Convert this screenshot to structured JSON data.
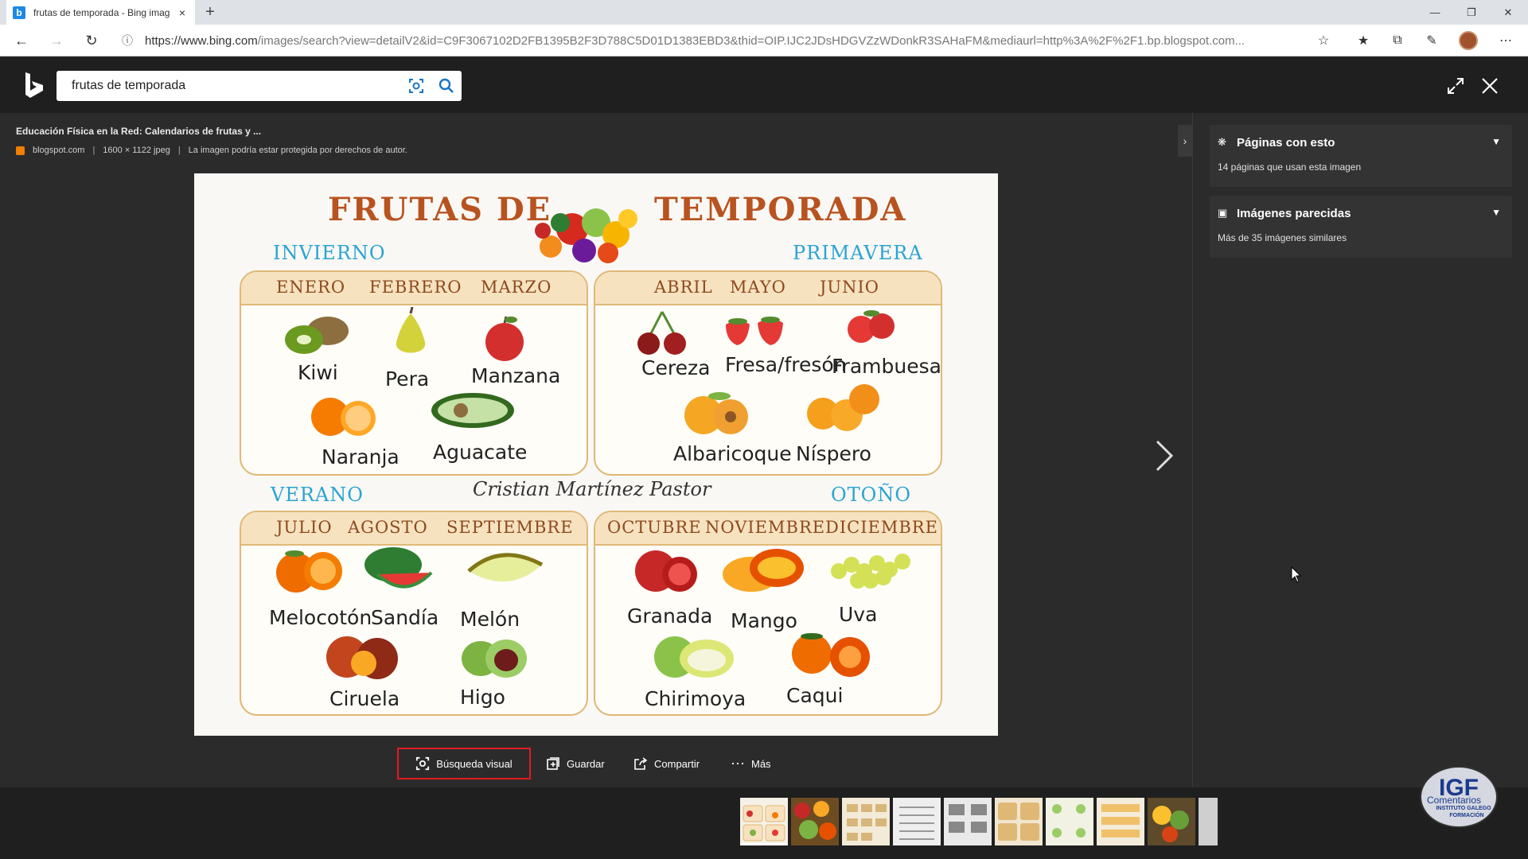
{
  "browser": {
    "tab_title": "frutas de temporada - Bing imag",
    "tab_close": "×",
    "new_tab": "+",
    "url_host": "https://www.bing.com",
    "url_path": "/images/search?view=detailV2&id=C9F3067102D2FB1395B2F3D788C5D01D1383EBD3&thid=OIP.IJC2JDsHDGVZzWDonkR3SAHaFM&mediaurl=http%3A%2F%2F1.bp.blogspot.com..."
  },
  "bing": {
    "search_query": "frutas de temporada"
  },
  "image_info": {
    "title": "Educación Física en la Red: Calendarios de frutas y ...",
    "source": "blogspot.com",
    "dimensions": "1600 × 1122 jpeg",
    "copyright": "La imagen podría estar protegida por derechos de autor."
  },
  "poster": {
    "title_left": "FRUTAS  DE",
    "title_right": "TEMPORADA",
    "author": "Cristian Martínez Pastor",
    "seasons": {
      "winter": "INVIERNO",
      "spring": "PRIMAVERA",
      "summer": "VERANO",
      "autumn": "OTOÑO"
    },
    "months": {
      "winter": [
        "ENERO",
        "FEBRERO",
        "MARZO"
      ],
      "spring": [
        "ABRIL",
        "MAYO",
        "JUNIO"
      ],
      "summer": [
        "JULIO",
        "AGOSTO",
        "SEPTIEMBRE"
      ],
      "autumn": [
        "OCTUBRE",
        "NOVIEMBRE",
        "DICIEMBRE"
      ]
    },
    "fruits": {
      "winter": [
        "Kiwi",
        "Pera",
        "Manzana",
        "Naranja",
        "Aguacate"
      ],
      "spring": [
        "Cereza",
        "Fresa/fresón",
        "Frambuesa",
        "Albaricoque",
        "Níspero"
      ],
      "summer": [
        "Melocotón",
        "Sandía",
        "Melón",
        "Ciruela",
        "Higo"
      ],
      "autumn": [
        "Granada",
        "Mango",
        "Uva",
        "Chirimoya",
        "Caqui"
      ]
    }
  },
  "actions": {
    "visual_search": "Búsqueda visual",
    "save": "Guardar",
    "share": "Compartir",
    "more": "Más"
  },
  "panel": {
    "pages_title": "Páginas con esto",
    "pages_sub": "14 páginas que usan esta imagen",
    "similar_title": "Imágenes parecidas",
    "similar_sub": "Más de 35 imágenes similares"
  },
  "watermark": {
    "text1": "Comentarios",
    "text2": "INSTITUTO GALEGO",
    "text3": "FORMACIÓN"
  },
  "colors": {
    "poster_title": "#b8531f",
    "season": "#2aa4d2",
    "visual_search_border": "#e31b23"
  }
}
